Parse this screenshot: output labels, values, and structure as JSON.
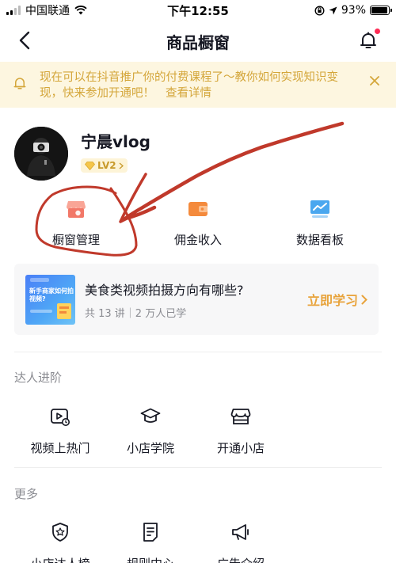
{
  "status_bar": {
    "carrier": "中国联通",
    "time": "下午12:55",
    "battery_percent": "93%",
    "battery_level": 0.93
  },
  "nav": {
    "title": "商品橱窗"
  },
  "notice": {
    "text": "现在可以在抖音推广你的付费课程了～教你如何实现知识变现，快来参加开通吧！",
    "link": "查看详情",
    "color": "#d4a63a",
    "background": "#fdf6e0"
  },
  "profile": {
    "username": "宁晨vlog",
    "level": "LV2"
  },
  "actions": [
    {
      "label": "橱窗管理",
      "icon": "storefront-icon",
      "color": "#f27868"
    },
    {
      "label": "佣金收入",
      "icon": "wallet-icon",
      "color": "#f48a3c"
    },
    {
      "label": "数据看板",
      "icon": "chart-board-icon",
      "color": "#4aa7ef"
    }
  ],
  "course": {
    "title": "美食类视频拍摄方向有哪些?",
    "meta": "共 13 讲｜2 万人已学",
    "cta": "立即学习",
    "thumb_text": "新手商家如何拍视频?"
  },
  "sections": {
    "expert": {
      "title": "达人进阶",
      "items": [
        {
          "label": "视频上热门",
          "icon": "video-hot-icon"
        },
        {
          "label": "小店学院",
          "icon": "graduation-cap-icon"
        },
        {
          "label": "开通小店",
          "icon": "shop-icon"
        }
      ]
    },
    "more": {
      "title": "更多",
      "items": [
        {
          "label": "小店达人榜",
          "icon": "star-badge-icon"
        },
        {
          "label": "规则中心",
          "icon": "document-icon"
        },
        {
          "label": "广告介绍",
          "icon": "megaphone-icon"
        }
      ]
    }
  },
  "colors": {
    "accent": "#e8a33b",
    "text_primary": "#161823",
    "text_secondary": "#8a8b91",
    "annotation": "#c0392b"
  }
}
